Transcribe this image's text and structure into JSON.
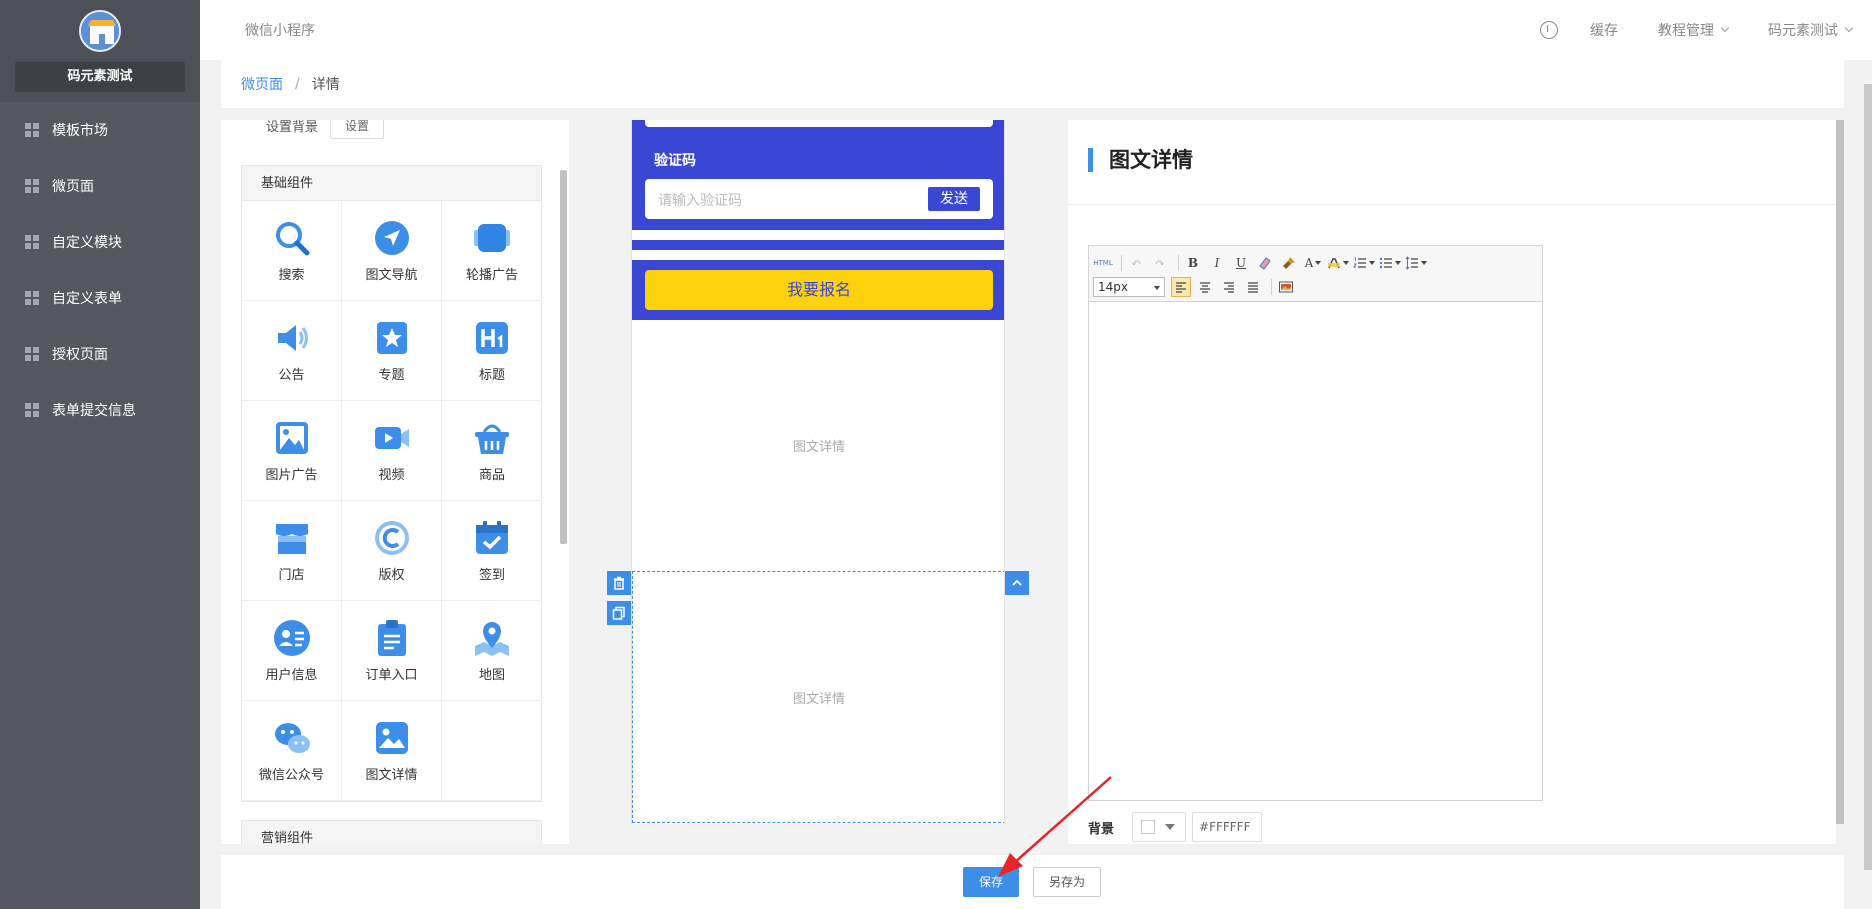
{
  "sidebar": {
    "shop_name": "码元素测试",
    "items": [
      {
        "label": "模板市场"
      },
      {
        "label": "微页面"
      },
      {
        "label": "自定义模块"
      },
      {
        "label": "自定义表单"
      },
      {
        "label": "授权页面"
      },
      {
        "label": "表单提交信息"
      }
    ]
  },
  "header": {
    "system_name": "微信小程序",
    "cache_label": "缓存",
    "tutorial_label": "教程管理",
    "account_label": "码元素测试"
  },
  "breadcrumb": {
    "parent": "微页面",
    "separator": "/",
    "current": "详情"
  },
  "left_panel": {
    "bg_label": "设置背景",
    "bg_button": "设置",
    "basic_section": "基础组件",
    "marketing_section": "营销组件",
    "components": [
      {
        "label": "搜索",
        "icon": "search-icon"
      },
      {
        "label": "图文导航",
        "icon": "navigation-icon"
      },
      {
        "label": "轮播广告",
        "icon": "carousel-icon"
      },
      {
        "label": "公告",
        "icon": "announcement-icon"
      },
      {
        "label": "专题",
        "icon": "topic-icon"
      },
      {
        "label": "标题",
        "icon": "heading-icon"
      },
      {
        "label": "图片广告",
        "icon": "image-ad-icon"
      },
      {
        "label": "视频",
        "icon": "video-icon"
      },
      {
        "label": "商品",
        "icon": "basket-icon"
      },
      {
        "label": "门店",
        "icon": "store-icon"
      },
      {
        "label": "版权",
        "icon": "copyright-icon"
      },
      {
        "label": "签到",
        "icon": "checkin-icon"
      },
      {
        "label": "用户信息",
        "icon": "user-info-icon"
      },
      {
        "label": "订单入口",
        "icon": "order-entry-icon"
      },
      {
        "label": "地图",
        "icon": "map-icon"
      },
      {
        "label": "微信公众号",
        "icon": "wechat-icon"
      },
      {
        "label": "图文详情",
        "icon": "image-text-icon"
      }
    ]
  },
  "phone": {
    "code_label": "验证码",
    "code_placeholder": "请输入验证码",
    "send_label": "发送",
    "signup_label": "我要报名",
    "block1_placeholder": "图文详情",
    "block2_placeholder": "图文详情"
  },
  "right_panel": {
    "title": "图文详情",
    "toolbar": {
      "html": "HTML",
      "bold": "B",
      "italic": "I",
      "underline": "U",
      "font_color": "A",
      "font_size": "14px"
    },
    "bg_label": "背景",
    "bg_value": "#FFFFFF"
  },
  "footer": {
    "save_label": "保存",
    "saveas_label": "另存为"
  },
  "colors": {
    "sidebar": "#55585e",
    "accent": "#3d8ee8",
    "phone_blue": "#3a47d5",
    "signup_yellow": "#fcd20a",
    "arrow": "#e8232a"
  }
}
